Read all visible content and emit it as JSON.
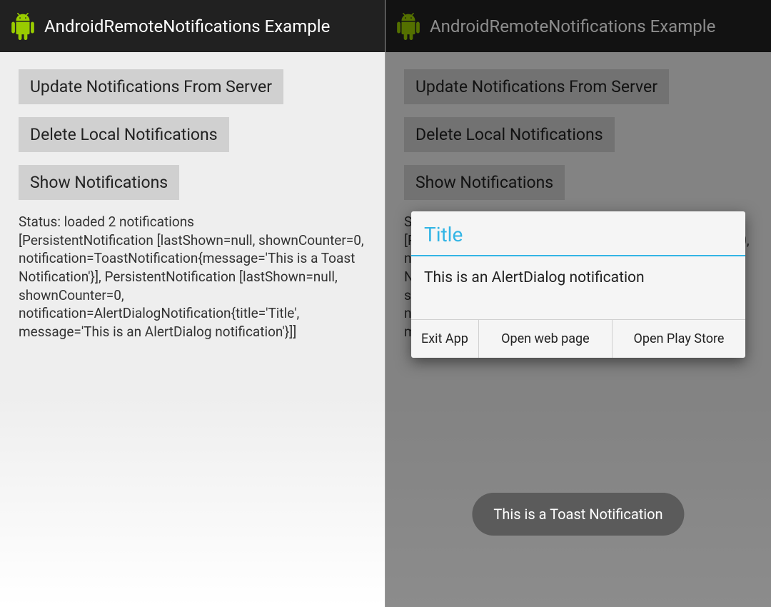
{
  "action_bar": {
    "title": "AndroidRemoteNotifications Example"
  },
  "buttons": {
    "update": "Update Notifications From Server",
    "delete": "Delete Local Notifications",
    "show": "Show Notifications"
  },
  "status": {
    "line1": "Status: loaded 2 notifications",
    "line2": "[PersistentNotification [lastShown=null, shownCounter=0, notification=ToastNotification{message='This is a Toast Notification'}], PersistentNotification [lastShown=null, shownCounter=0, notification=AlertDialogNotification{title='Title', message='This is an AlertDialog notification'}]]"
  },
  "dialog": {
    "title": "Title",
    "message": "This is an AlertDialog notification",
    "btn_exit": "Exit App",
    "btn_web": "Open web page",
    "btn_store": "Open Play Store"
  },
  "toast": {
    "message": "This is a Toast Notification"
  }
}
